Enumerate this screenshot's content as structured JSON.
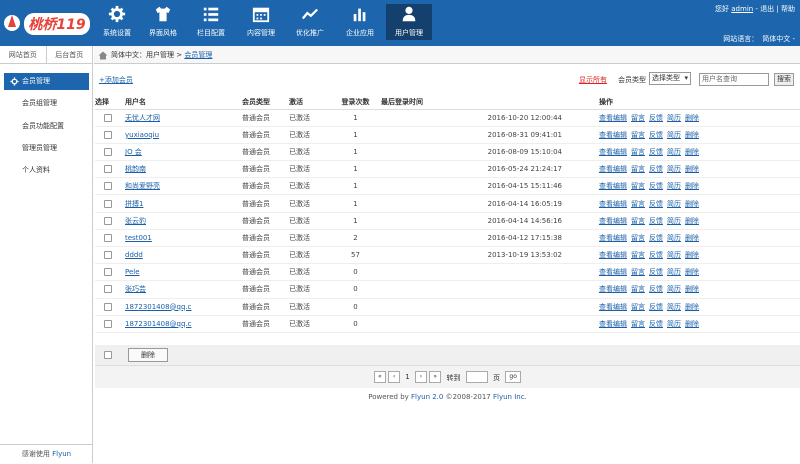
{
  "logo": {
    "text": "桃桥119"
  },
  "nav": [
    {
      "label": "系统设置",
      "icon": "gear-icon"
    },
    {
      "label": "界面风格",
      "icon": "shirt-icon"
    },
    {
      "label": "栏目配置",
      "icon": "list-icon"
    },
    {
      "label": "内容管理",
      "icon": "calendar-icon"
    },
    {
      "label": "优化推广",
      "icon": "trend-icon"
    },
    {
      "label": "企业应用",
      "icon": "bar-chart-icon"
    },
    {
      "label": "用户管理",
      "icon": "user-icon"
    }
  ],
  "user": {
    "greeting": "您好",
    "name": "admin",
    "sep1": " - ",
    "logout": "退出",
    "sep2": " | ",
    "help": "帮助"
  },
  "lang": {
    "label": "网站语言：",
    "value": "简体中文 -"
  },
  "side": {
    "tabs": [
      "网站首页",
      "后台首页"
    ],
    "items": [
      "会员管理",
      "会员组管理",
      "会员功能配置",
      "管理员管理",
      "个人资料"
    ],
    "footer_prefix": "感谢使用",
    "footer_brand": "Flyun"
  },
  "crumb": {
    "prefix": "简体中文：用户管理 > ",
    "link": "会员管理"
  },
  "toolbar": {
    "add": "+添加会员",
    "show_all": "显示所有",
    "type_label": "会员类型",
    "type_value": "选择类型",
    "search_placeholder": "用户名查询",
    "search_btn": "搜索"
  },
  "table": {
    "headers": [
      "选择",
      "用户名",
      "会员类型",
      "激活",
      "登录次数",
      "最后登录时间",
      "操作"
    ],
    "ops": [
      "查看编辑",
      "留言",
      "反馈",
      "简历",
      "删除"
    ],
    "rows": [
      {
        "name": "无忧人才网",
        "type": "普通会员",
        "status": "已激活",
        "count": "1",
        "time": "2016-10-20 12:00:44"
      },
      {
        "name": "yuxiaoqiu",
        "type": "普通会员",
        "status": "已激活",
        "count": "1",
        "time": "2016-08-31 09:41:01"
      },
      {
        "name": "JO 会",
        "type": "普通会员",
        "status": "已激活",
        "count": "1",
        "time": "2016-08-09 15:10:04"
      },
      {
        "name": "桃韵南",
        "type": "普通会员",
        "status": "已激活",
        "count": "1",
        "time": "2016-05-24 21:24:17"
      },
      {
        "name": "和尚爱野亮",
        "type": "普通会员",
        "status": "已激活",
        "count": "1",
        "time": "2016-04-15 15:11:46"
      },
      {
        "name": "拼搏1",
        "type": "普通会员",
        "status": "已激活",
        "count": "1",
        "time": "2016-04-14 16:05:19"
      },
      {
        "name": "张云豹",
        "type": "普通会员",
        "status": "已激活",
        "count": "1",
        "time": "2016-04-14 14:56:16"
      },
      {
        "name": "test001",
        "type": "普通会员",
        "status": "已激活",
        "count": "2",
        "time": "2016-04-12 17:15:38"
      },
      {
        "name": "dddd",
        "type": "普通会员",
        "status": "已激活",
        "count": "57",
        "time": "2013-10-19 13:53:02"
      },
      {
        "name": "Pele",
        "type": "普通会员",
        "status": "已激活",
        "count": "0",
        "time": ""
      },
      {
        "name": "张巧芸",
        "type": "普通会员",
        "status": "已激活",
        "count": "0",
        "time": ""
      },
      {
        "name": "1872301408@qq.c",
        "type": "普通会员",
        "status": "已激活",
        "count": "0",
        "time": ""
      },
      {
        "name": "1872301408@qq.c",
        "type": "普通会员",
        "status": "已激活",
        "count": "0",
        "time": ""
      }
    ]
  },
  "bulk": {
    "delete": "删除"
  },
  "pager": {
    "first": "«",
    "prev": "‹",
    "page": "1",
    "next": "›",
    "last": "»",
    "goto": "转到",
    "unit": "页",
    "go": "go"
  },
  "footer": {
    "prefix": "Powered by ",
    "brand": "Flyun 2.0",
    "middle": " ©2008-2017 ",
    "company": "Flyun Inc."
  },
  "colors": {
    "header": "#1d66ad",
    "active_nav": "#14406e",
    "link": "#1a5fa8",
    "alert": "#dd2222"
  }
}
